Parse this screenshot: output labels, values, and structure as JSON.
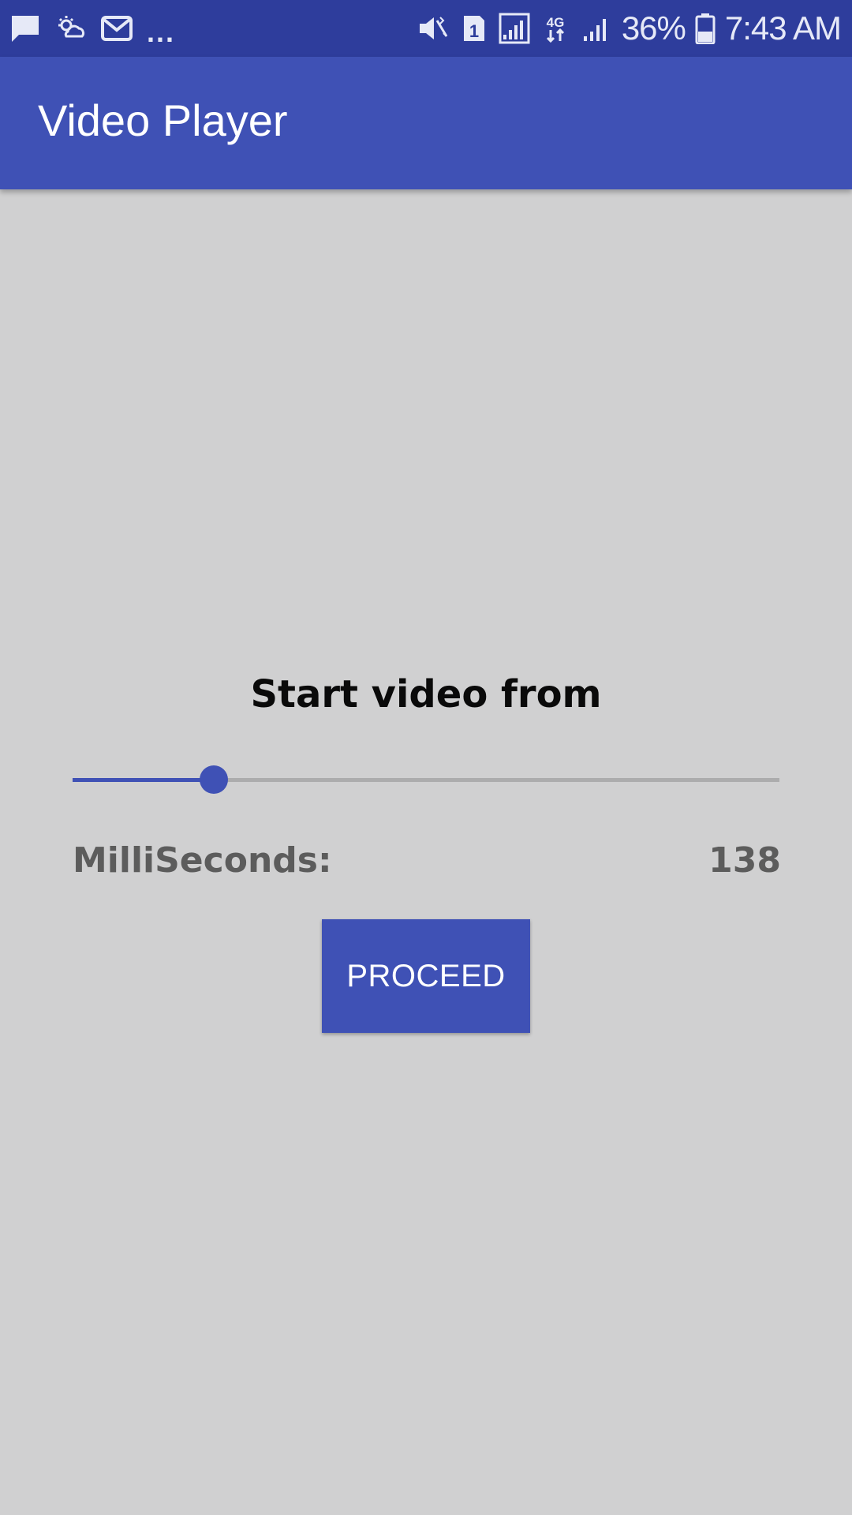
{
  "status_bar": {
    "left_icons": [
      "message-icon",
      "weather-icon",
      "email-icon"
    ],
    "more": "...",
    "right_icons": [
      "vibrate-mute-icon",
      "sim-1-icon",
      "signal-icon",
      "4g-data-icon",
      "signal-icon"
    ],
    "battery": "36%",
    "time": "7:43 AM"
  },
  "app_bar": {
    "title": "Video Player"
  },
  "content": {
    "heading": "Start video from",
    "slider": {
      "value_fraction": 0.2
    },
    "ms_label": "MilliSeconds:",
    "ms_value": "138",
    "proceed_label": "PROCEED"
  },
  "colors": {
    "status_bar": "#2e3d9c",
    "primary": "#3f51b5",
    "background": "#d0d0d1",
    "track": "#acacad",
    "secondary_text": "#5c5c5c"
  }
}
